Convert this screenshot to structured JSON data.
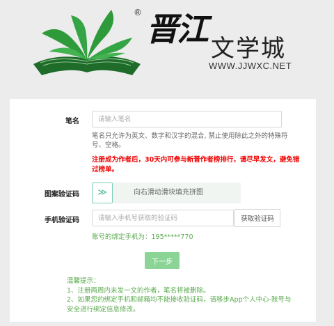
{
  "brand": {
    "title": "晋江",
    "subtitle": "文学城",
    "url": "WWW.JJWXC.NET",
    "registered": "®"
  },
  "form": {
    "penname": {
      "label": "笔名",
      "placeholder": "请输入笔名",
      "hint": "笔名只允许为英文、数字和汉字的混合, 禁止使用除此之外的特殊符号、空格。",
      "warning": "注册成为作者后，30天内可参与新晋作者榜排行，请尽早发文，避免错过榜单。"
    },
    "captcha": {
      "label": "图案验证码",
      "handle": "≫",
      "text": "向右滑动滑块填充拼图"
    },
    "phone_code": {
      "label": "手机验证码",
      "placeholder": "请输入手机号获取的验证码",
      "button": "获取验证码",
      "bound_note": "账号的绑定手机为：195*****770"
    },
    "next_button": "下一步"
  },
  "tips": {
    "title": "温馨提示：",
    "line1": "1、注册两周内未发一文的作者，笔名将被删除。",
    "line2": "2、如果您的绑定手机和邮箱均不能接收验证码，请移步App个人中心-账号与安全进行绑定信息修改。"
  },
  "colors": {
    "accent_green": "#5aaa4e",
    "button_green": "#8bd495",
    "warning_red": "#e00000",
    "logo_green": "#2e9a3a"
  }
}
